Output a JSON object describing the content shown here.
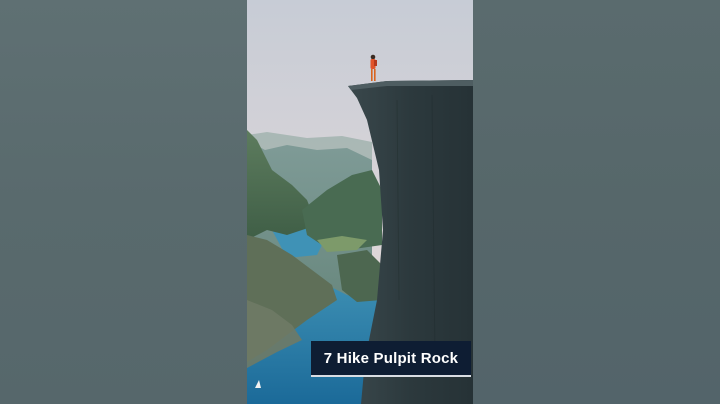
{
  "caption": {
    "text": "7 Hike Pulpit Rock"
  },
  "scene": {
    "subject": "hiker-on-cliff-edge",
    "colors": {
      "sky_top": "#c9cdd6",
      "sky_bottom": "#e7dcd6",
      "fjord_water": "#1f74a3",
      "cliff": "#2d3a3f",
      "caption_bg": "#0e1d33",
      "pillar_bg": "#5b6b6f"
    }
  }
}
